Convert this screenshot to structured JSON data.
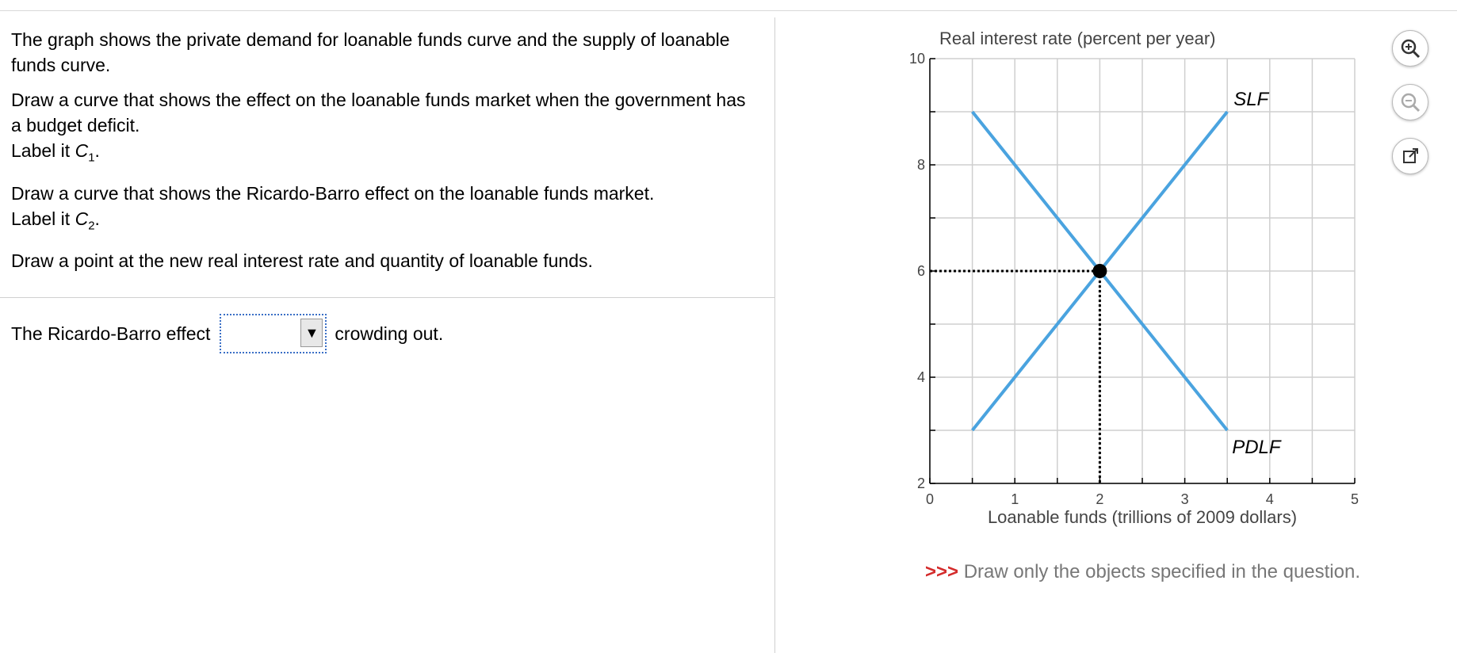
{
  "instructions": {
    "p1": "The graph shows the private demand for loanable funds curve and the supply of loanable funds curve.",
    "p2_line1": "Draw a curve that shows the effect on the loanable funds  market when the government has a budget deficit.",
    "p2_label_prefix": "Label it ",
    "p2_label_c": "C",
    "p2_label_sub": "1",
    "p3_line1": "Draw a curve that shows the Ricardo-Barro effect on the loanable funds market.",
    "p3_label_prefix": "Label it ",
    "p3_label_c": "C",
    "p3_label_sub": "2",
    "p4": "Draw a point at the new real interest rate and quantity of loanable funds."
  },
  "question": {
    "prefix": "The Ricardo-Barro effect",
    "selected": "",
    "suffix": "crowding out."
  },
  "tools": {
    "zoom_in": "zoom-in-icon",
    "zoom_out": "zoom-out-icon",
    "popout": "external-link-icon"
  },
  "note": {
    "chevrons": ">>>",
    "text": "Draw only the objects specified in the question."
  },
  "chart_data": {
    "type": "line",
    "ylabel": "Real interest rate (percent per year)",
    "xlabel": "Loanable funds (trillions of 2009 dollars)",
    "xlim": [
      0,
      5
    ],
    "ylim": [
      2,
      10
    ],
    "x_ticks": [
      "0",
      "1",
      "2",
      "3",
      "4",
      "5"
    ],
    "y_ticks": [
      "2",
      "4",
      "6",
      "8",
      "10"
    ],
    "grid": true,
    "series": [
      {
        "name": "SLF",
        "points": [
          [
            0.5,
            3
          ],
          [
            3.5,
            9
          ]
        ],
        "color": "#4aa3df"
      },
      {
        "name": "PDLF",
        "points": [
          [
            0.5,
            9
          ],
          [
            3.5,
            3
          ]
        ],
        "color": "#4aa3df"
      }
    ],
    "equilibrium": {
      "x": 2,
      "y": 6
    }
  }
}
